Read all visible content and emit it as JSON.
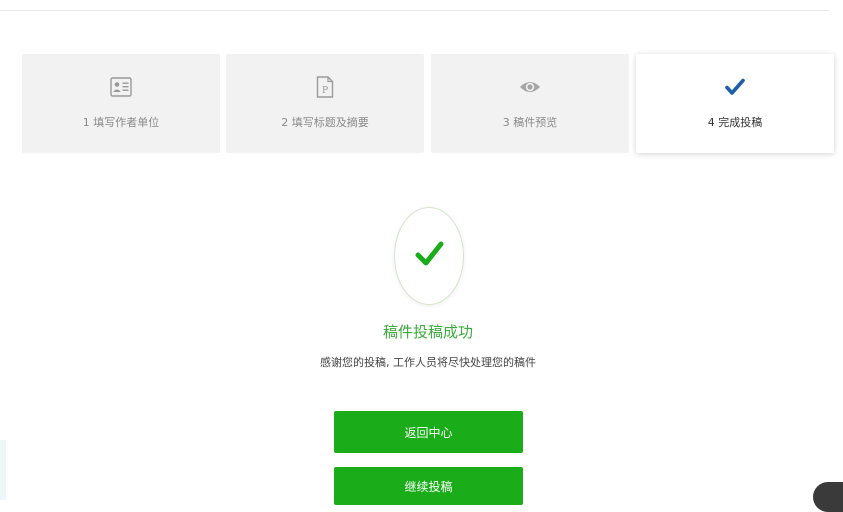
{
  "steps": [
    {
      "label": "1 填写作者单位",
      "icon": "contact-card-icon",
      "active": false
    },
    {
      "label": "2 填写标题及摘要",
      "icon": "document-p-icon",
      "active": false
    },
    {
      "label": "3 稿件预览",
      "icon": "eye-icon",
      "active": false
    },
    {
      "label": "4 完成投稿",
      "icon": "checkmark-icon",
      "active": true
    }
  ],
  "success": {
    "icon": "success-check-icon",
    "title": "稿件投稿成功",
    "message": "感谢您的投稿, 工作人员将尽快处理您的稿件"
  },
  "buttons": {
    "back_label": "返回中心",
    "continue_label": "继续投稿"
  },
  "colors": {
    "accent_green": "#1aad19",
    "title_green": "#3bab3b",
    "active_check_blue": "#1f5fa8",
    "step_bg": "#f2f2f2"
  }
}
